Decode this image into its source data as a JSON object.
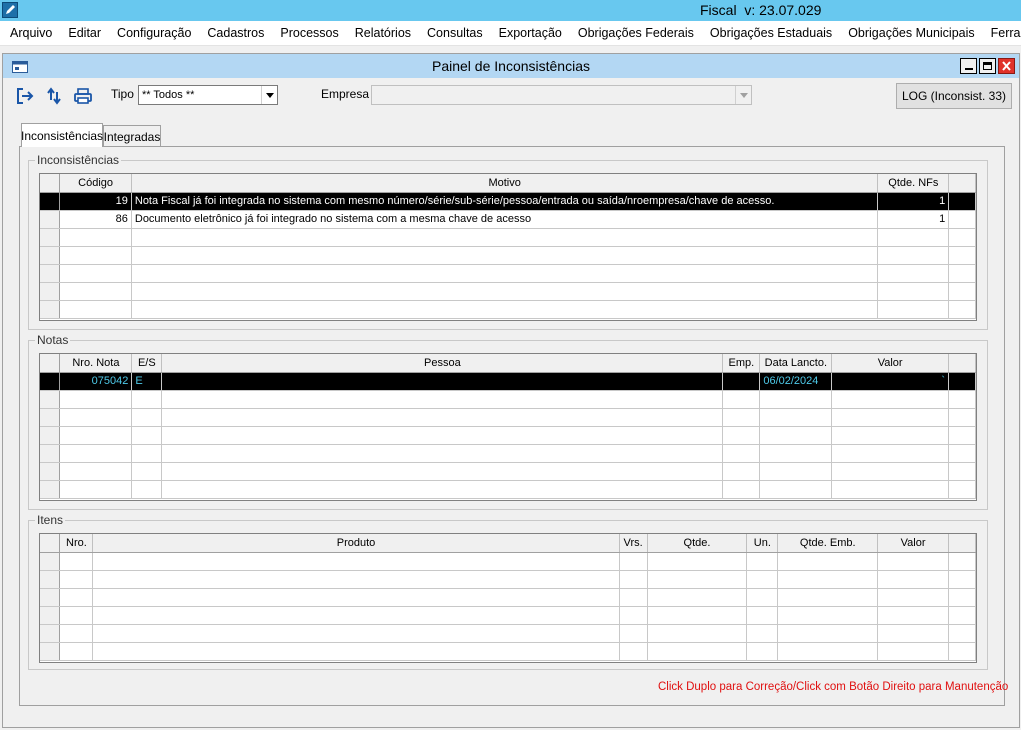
{
  "app": {
    "title": "Fiscal  v: 23.07.029"
  },
  "menu": [
    "Arquivo",
    "Editar",
    "Configuração",
    "Cadastros",
    "Processos",
    "Relatórios",
    "Consultas",
    "Exportação",
    "Obrigações Federais",
    "Obrigações Estaduais",
    "Obrigações Municipais",
    "Ferramentas"
  ],
  "window": {
    "title": "Painel de Inconsistências"
  },
  "toolbar": {
    "tipo_label": "Tipo",
    "tipo_value": "** Todos **",
    "empresa_label": "Empresa",
    "empresa_value": "",
    "log_button": "LOG (Inconsist. 33)"
  },
  "tabs": [
    "Inconsistências",
    "Integradas"
  ],
  "inconsistencias": {
    "legend": "Inconsistências",
    "columns": [
      "Código",
      "Motivo",
      "Qtde. NFs"
    ],
    "rows": [
      {
        "codigo": "19",
        "motivo": "Nota Fiscal já foi integrada no sistema com mesmo número/série/sub-série/pessoa/entrada ou saída/nroempresa/chave de acesso.",
        "qtde": "1"
      },
      {
        "codigo": "86",
        "motivo": "Documento eletrônico já foi integrado no sistema com a mesma chave de acesso",
        "qtde": "1"
      }
    ]
  },
  "notas": {
    "legend": "Notas",
    "columns": [
      "Nro. Nota",
      "E/S",
      "Pessoa",
      "Emp.",
      "Data Lancto.",
      "Valor"
    ],
    "rows": [
      {
        "nro": "075042",
        "es": "E",
        "pessoa": "",
        "emp": "",
        "data": "06/02/2024",
        "valor": "`"
      }
    ]
  },
  "itens": {
    "legend": "Itens",
    "columns": [
      "Nro.",
      "Produto",
      "Vrs.",
      "Qtde.",
      "Un.",
      "Qtde. Emb.",
      "Valor"
    ]
  },
  "footer": {
    "hint": "Click Duplo para Correção/Click com Botão Direito para Manutenção"
  },
  "colors": {
    "app_titlebar": "#68c8ef",
    "child_titlebar": "#b3d7f3",
    "selected_row": "#000000",
    "hint_text": "#e01010"
  }
}
